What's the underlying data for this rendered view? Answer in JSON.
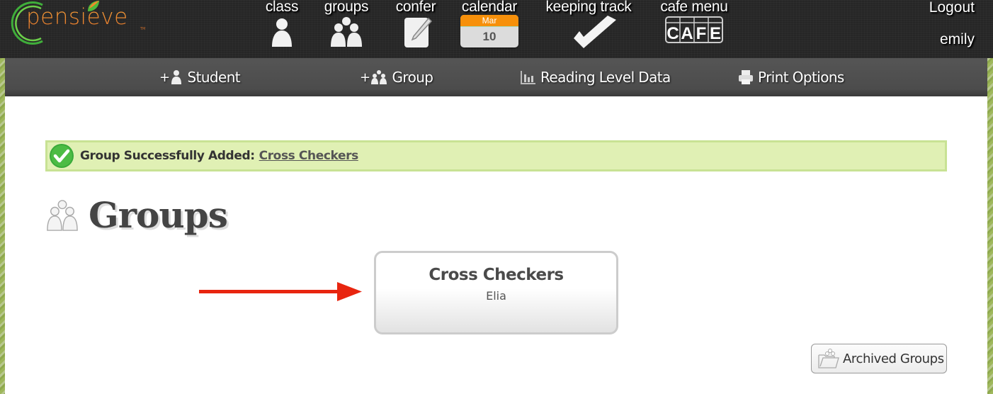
{
  "brand": {
    "name": "pensieve",
    "trademark": "TM"
  },
  "top_nav": [
    {
      "label": "class",
      "icon": "person-icon"
    },
    {
      "label": "groups",
      "icon": "group-icon"
    },
    {
      "label": "confer",
      "icon": "notepad-pencil-icon"
    },
    {
      "label": "calendar",
      "icon": "calendar-icon",
      "month": "Mar",
      "day": "10"
    },
    {
      "label": "keeping track",
      "icon": "checkmark-icon"
    },
    {
      "label": "cafe menu",
      "icon": "cafe-icon",
      "icon_text": "CAFE"
    }
  ],
  "user": {
    "logout_label": "Logout",
    "username": "emily"
  },
  "sub_nav": [
    {
      "prefix": "+",
      "label": "Student",
      "icon": "person-icon"
    },
    {
      "prefix": "+",
      "label": "Group",
      "icon": "group-icon"
    },
    {
      "prefix": "",
      "label": "Reading Level Data",
      "icon": "bar-chart-icon"
    },
    {
      "prefix": "",
      "label": "Print Options",
      "icon": "printer-icon"
    }
  ],
  "alert": {
    "message": "Group Successfully Added:",
    "link_text": "Cross Checkers",
    "colors": {
      "background": "#e0f0b4",
      "border": "#c8e294",
      "icon": "#3aaa3a"
    }
  },
  "page": {
    "title": "Groups"
  },
  "groups": [
    {
      "name": "Cross Checkers",
      "members": "Elia"
    }
  ],
  "archived_button": {
    "label": "Archived Groups"
  },
  "annotation": {
    "color": "#e8250f"
  },
  "colors": {
    "calendar_month": "#f7900a",
    "logo_orange": "#f08a2a",
    "logo_green": "#4cbb3a"
  }
}
